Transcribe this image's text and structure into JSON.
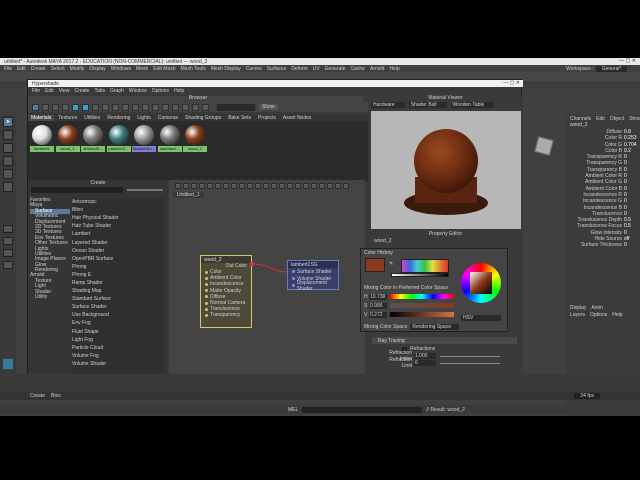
{
  "window": {
    "title": "untitled* - Autodesk MAYA 2017.2 - EDUCATION (NON-COMMERCIAL): untitled --- wood_2"
  },
  "main_menu": [
    "File",
    "Edit",
    "Create",
    "Select",
    "Modify",
    "Display",
    "Windows",
    "Mesh",
    "Edit Mesh",
    "Mesh Tools",
    "Mesh Display",
    "Curves",
    "Surfaces",
    "Deform",
    "UV",
    "Generate",
    "Cache",
    "Arnold",
    "Help"
  ],
  "workspace": {
    "label": "Workspace :",
    "value": "General*"
  },
  "hypershade": {
    "title": "Hypershade",
    "menu": [
      "File",
      "Edit",
      "View",
      "Create",
      "Tabs",
      "Graph",
      "Window",
      "Options",
      "Help"
    ],
    "browser_title": "Browser",
    "show_label": "Show",
    "browser_tabs": [
      "Materials",
      "Textures",
      "Utilities",
      "Rendering",
      "Lights",
      "Cameras",
      "Shading Groups",
      "Bake Sets",
      "Projects",
      "Asset Nodes"
    ],
    "materials": [
      {
        "name": "lambert1",
        "color": "#e0e0e0",
        "sel": true
      },
      {
        "name": "wood_1",
        "color": "#8a3c1c",
        "sel": true
      },
      {
        "name": "aiStandS...",
        "color": "#7a7a7a",
        "sel": true
      },
      {
        "name": "particleCl...",
        "color": "#3a7a7a",
        "sel": true
      },
      {
        "name": "shaderGlo...",
        "color": "#999999",
        "sel": false
      },
      {
        "name": "standard...",
        "color": "#777777",
        "sel": true
      },
      {
        "name": "wood_2",
        "color": "#8a3c1c",
        "sel": true
      }
    ],
    "create_title": "Create",
    "create_tree": [
      "Favorites",
      "Maya",
      "Surface",
      "Volumetric",
      "Displacement",
      "2D Textures",
      "3D Textures",
      "Env Textures",
      "Other Textures",
      "Lights",
      "Utilities",
      "Image Planes",
      "Glow",
      "Rendering",
      "Arnold",
      "Texture",
      "Light",
      "Shader",
      "Utility"
    ],
    "node_list": [
      {
        "label": "Anisotropic",
        "c": "#8a6a40"
      },
      {
        "label": "Blinn",
        "c": "#7a7a7a"
      },
      {
        "label": "Hair Physical Shader",
        "c": "#707070"
      },
      {
        "label": "Hair Tube Shader",
        "c": "#606060"
      },
      {
        "label": "Lambert",
        "c": "#8a8a8a"
      },
      {
        "label": "Layered Shader",
        "c": "#7a6a5a"
      },
      {
        "label": "Ocean Shader",
        "c": "#3a6a8a"
      },
      {
        "label": "OpenPBR Surface",
        "c": "#8a8a8a"
      },
      {
        "label": "Phong",
        "c": "#7a7a7a"
      },
      {
        "label": "Phong E",
        "c": "#6a6a6a"
      },
      {
        "label": "Ramp Shader",
        "c": "#aa6a3a"
      },
      {
        "label": "Shading Map",
        "c": "#8a5a3a"
      },
      {
        "label": "Standard Surface",
        "c": "#9a9a9a"
      },
      {
        "label": "Surface Shader",
        "c": "#5a8a5a"
      },
      {
        "label": "Use Background",
        "c": "#6a6a6a"
      },
      {
        "label": "Env Fog",
        "c": "#6a6a8a"
      },
      {
        "label": "Fluid Shape",
        "c": "#5a7a9a"
      },
      {
        "label": "Light Fog",
        "c": "#7a7a9a"
      },
      {
        "label": "Particle Cloud",
        "c": "#7a7a7a"
      },
      {
        "label": "Volume Fog",
        "c": "#6a6a6a"
      },
      {
        "label": "Volume Shader",
        "c": "#5a5a5a"
      }
    ],
    "graph_tab": "Untitled_1",
    "node_wood": {
      "title": "wood_2",
      "out": "Out Color",
      "attrs": [
        "Color",
        "Ambient Color",
        "Incandescence",
        "Matte Opacity",
        "Diffuse",
        "Normal Camera",
        "Translucence",
        "Transparency"
      ]
    },
    "node_lambert": {
      "title": "lambert2SG",
      "attrs": [
        "Surface Shader",
        "Volume Shader",
        "Displacement Shader"
      ]
    },
    "viewer_title": "Material Viewer",
    "viewer_opts": [
      "Hardware",
      "Shader Ball",
      "Wooden Table"
    ],
    "property_title": "Property Editor",
    "property_node": "wood_2",
    "ray_tracing": "Ray Tracing",
    "refractions": "Refractions",
    "refraction_index": {
      "label": "Refraction Index",
      "value": "1.000"
    },
    "refraction_limit": {
      "label": "Refraction Limit",
      "value": "6"
    }
  },
  "color_history": {
    "title": "Color History",
    "mixing_label": "Mixing Color in Preferred Color Space",
    "hsv": [
      {
        "k": "H",
        "v": "10.738"
      },
      {
        "k": "S",
        "v": "0.986"
      },
      {
        "k": "V",
        "v": "0.272"
      }
    ],
    "mode": "HSV",
    "space_label": "Mixing Color Space",
    "space_value": "Rendering Space"
  },
  "channels": {
    "tabs": [
      "Channels",
      "Edit",
      "Object",
      "Show"
    ],
    "node": "wood_2",
    "attrs": [
      {
        "k": "Diffuse",
        "v": "0.8"
      },
      {
        "k": "Color R",
        "v": "0.253"
      },
      {
        "k": "Color G",
        "v": "0.704"
      },
      {
        "k": "Color B",
        "v": "0.2"
      },
      {
        "k": "Transparency R",
        "v": "0"
      },
      {
        "k": "Transparency G",
        "v": "0"
      },
      {
        "k": "Transparency B",
        "v": "0"
      },
      {
        "k": "Ambient Color R",
        "v": "0"
      },
      {
        "k": "Ambient Color G",
        "v": "0"
      },
      {
        "k": "Ambient Color B",
        "v": "0"
      },
      {
        "k": "Incandescence R",
        "v": "0"
      },
      {
        "k": "Incandescence G",
        "v": "0"
      },
      {
        "k": "Incandescence B",
        "v": "0"
      },
      {
        "k": "Translucence",
        "v": "0"
      },
      {
        "k": "Translucence Depth",
        "v": "0.5"
      },
      {
        "k": "Translucence Focus",
        "v": "0.5"
      },
      {
        "k": "Glow Intensity",
        "v": "0"
      },
      {
        "k": "Hide Source",
        "v": "off"
      },
      {
        "k": "Surface Thickness",
        "v": "0"
      }
    ],
    "bottom_tabs": [
      "Display",
      "Anim"
    ],
    "bottom_menu": [
      "Layers",
      "Options",
      "Help"
    ]
  },
  "bottom": {
    "create": "Create",
    "bins": "Bins",
    "frame": "24 fps",
    "mel": "MEL",
    "result": "// Result: wood_2"
  }
}
